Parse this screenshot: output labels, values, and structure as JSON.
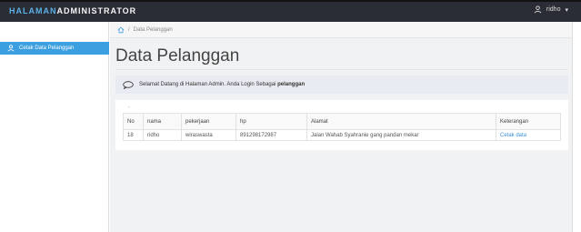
{
  "header": {
    "brand_part1": "HALAMAN",
    "brand_part2": "ADMINISTRATOR",
    "user_name": "ridho",
    "user_caret": "▾"
  },
  "sidebar": {
    "items": [
      {
        "label": "Cetak Data Pelanggan",
        "icon": "user-icon",
        "active": true
      }
    ]
  },
  "breadcrumb": {
    "separator": "/",
    "current": "Data Pelanggan"
  },
  "main": {
    "title": "Data Pelanggan",
    "welcome_text": "Selamat Datang di Halaman Admin. Anda Login Sebagai ",
    "welcome_role": "pelanggan",
    "panel_mark": "."
  },
  "table": {
    "columns": [
      "No",
      "nama",
      "pekerjaan",
      "hp",
      "Alamat",
      "Keterangan"
    ],
    "rows": [
      {
        "no": "18",
        "nama": "ridho",
        "pekerjaan": "wiraswasta",
        "hp": "891298172987",
        "alamat": "Jalan Wahab Syahranie gang pandan mekar",
        "keterangan": "Cetak data"
      }
    ]
  },
  "colors": {
    "topbar": "#2a2d35",
    "brand_accent": "#5ab0e8",
    "sidebar_active": "#3c9fe0",
    "link": "#3a8fd6"
  }
}
